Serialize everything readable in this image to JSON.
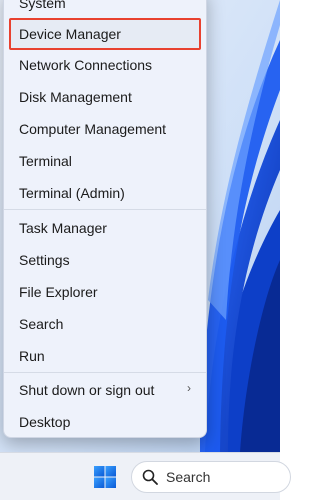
{
  "menu": {
    "items_top": [
      {
        "label": "System"
      },
      {
        "label": "Device Manager"
      },
      {
        "label": "Network Connections"
      },
      {
        "label": "Disk Management"
      },
      {
        "label": "Computer Management"
      },
      {
        "label": "Terminal"
      },
      {
        "label": "Terminal (Admin)"
      }
    ],
    "items_bottom": [
      {
        "label": "Task Manager"
      },
      {
        "label": "Settings"
      },
      {
        "label": "File Explorer"
      },
      {
        "label": "Search"
      },
      {
        "label": "Run"
      }
    ],
    "shutdown": {
      "label": "Shut down or sign out",
      "chevron": "›"
    },
    "desktop": {
      "label": "Desktop"
    },
    "highlight_color": "#e8412f"
  },
  "taskbar": {
    "search_label": "Search",
    "start_icon": "windows-logo-icon",
    "search_icon": "search-icon"
  }
}
